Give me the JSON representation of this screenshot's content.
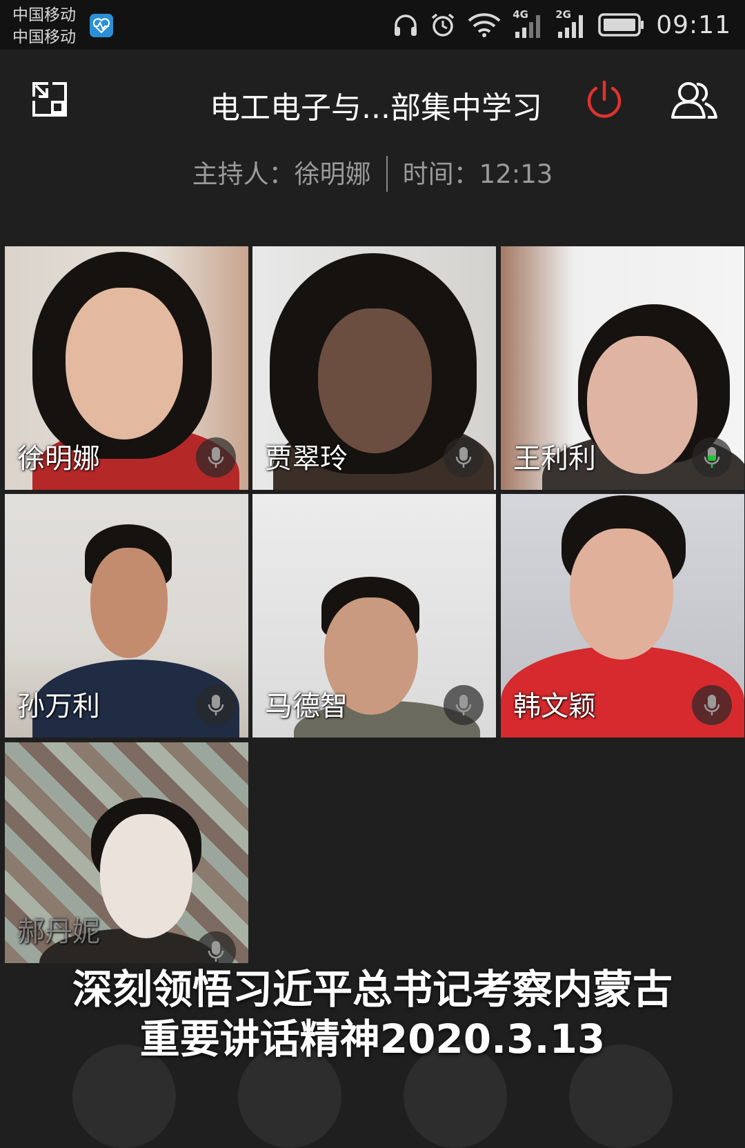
{
  "status_bar": {
    "carrier_1": "中国移动",
    "carrier_2": "中国移动",
    "network_1": "4G",
    "network_2": "2G",
    "time": "09:11",
    "icons": [
      "health-app-icon",
      "headphones-icon",
      "alarm-icon",
      "wifi-icon",
      "signal-icon",
      "battery-icon"
    ]
  },
  "header": {
    "title": "电工电子与...部集中学习",
    "minimize_icon": "minimize-window-icon",
    "end_icon": "power-icon",
    "members_icon": "members-icon"
  },
  "meeting_info": {
    "host_label": "主持人：",
    "host_name": "徐明娜",
    "time_label": "时间：",
    "time_value": "12:13"
  },
  "participants": [
    {
      "name": "徐明娜",
      "mic_active": false
    },
    {
      "name": "贾翠玲",
      "mic_active": false
    },
    {
      "name": "王利利",
      "mic_active": true
    },
    {
      "name": "孙万利",
      "mic_active": false
    },
    {
      "name": "马德智",
      "mic_active": false
    },
    {
      "name": "韩文颖",
      "mic_active": false
    },
    {
      "name": "郝丹妮",
      "mic_active": false
    }
  ],
  "caption": {
    "line1": "深刻领悟习近平总书记考察内蒙古",
    "line2": "重要讲话精神2020.3.13"
  },
  "colors": {
    "background": "#1f1f1f",
    "status_bar": "#121212",
    "end_button": "#e0322d",
    "mic_active": "#22c33a",
    "meta_text": "#9a9a9a"
  }
}
